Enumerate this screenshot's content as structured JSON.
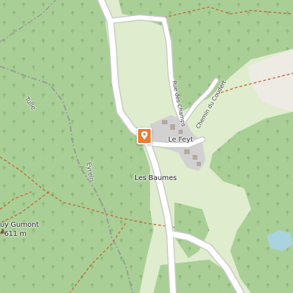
{
  "map": {
    "labels": {
      "tulle": "Tulle",
      "eyrein": "Eyrein",
      "rue_des_champs": "Rue des Champs",
      "chemin_du_coudert": "Chemin du Coudert",
      "le_feyt": "Le Feyt",
      "les_baumes": "Les Baumes",
      "puy_gumont": "uy Gumont",
      "elevation": "611 m"
    },
    "icons": {
      "marker": "map-pin-icon"
    },
    "colors": {
      "forest": "#a9cf96",
      "meadow": "#dfeccd",
      "road": "#ffffff",
      "settlement": "#d1d1d1",
      "water": "#aad3df",
      "marker": "#ef7a2f",
      "boundary": "#9a9a9a",
      "trail": "#c07040"
    }
  }
}
